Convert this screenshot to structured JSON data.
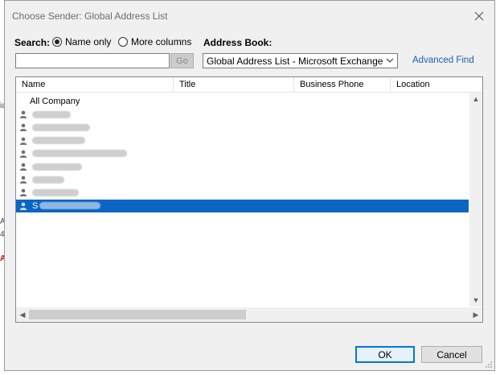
{
  "window": {
    "title": "Choose Sender: Global Address List"
  },
  "background_fragments": [
    "ia",
    "A",
    "4"
  ],
  "search": {
    "label": "Search:",
    "options": [
      "Name only",
      "More columns"
    ],
    "selected": "Name only",
    "input_value": "",
    "go_label": "Go"
  },
  "address_book": {
    "label": "Address Book:",
    "selected": "Global Address List - Microsoft Exchange"
  },
  "advanced_find": "Advanced Find",
  "list": {
    "columns": [
      "Name",
      "Title",
      "Business Phone",
      "Location"
    ],
    "rows": [
      {
        "name": "All Company",
        "icon": "",
        "redacted": false
      },
      {
        "name": "",
        "icon": "person-icon",
        "redacted": true
      },
      {
        "name": "",
        "icon": "person-icon",
        "redacted": true
      },
      {
        "name": "",
        "icon": "person-icon",
        "redacted": true
      },
      {
        "name": "",
        "icon": "person-icon",
        "redacted": true
      },
      {
        "name": "",
        "icon": "person-icon",
        "redacted": true
      },
      {
        "name": "",
        "icon": "person-icon",
        "redacted": true
      },
      {
        "name": "",
        "icon": "person-icon",
        "redacted": true
      },
      {
        "name": "S",
        "icon": "person-icon",
        "redacted": true,
        "selected": true
      }
    ]
  },
  "buttons": {
    "ok": "OK",
    "cancel": "Cancel"
  },
  "colors": {
    "selection": "#0a66c2",
    "link": "#1a5fb4"
  }
}
